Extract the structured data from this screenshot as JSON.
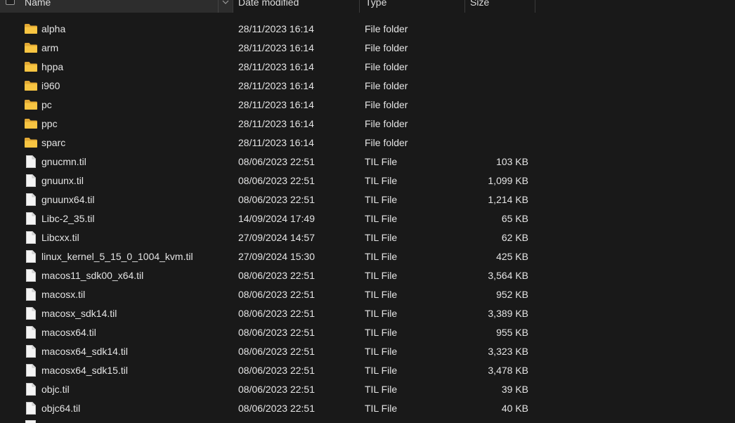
{
  "header": {
    "name": "Name",
    "date_modified": "Date modified",
    "type": "Type",
    "size": "Size"
  },
  "colors": {
    "background": "#191919",
    "folder": "#f8c542",
    "text": "#e4e4e4"
  },
  "files": [
    {
      "name": "alpha",
      "date": "28/11/2023 16:14",
      "type": "File folder",
      "size": "",
      "icon": "folder-icon"
    },
    {
      "name": "arm",
      "date": "28/11/2023 16:14",
      "type": "File folder",
      "size": "",
      "icon": "folder-icon"
    },
    {
      "name": "hppa",
      "date": "28/11/2023 16:14",
      "type": "File folder",
      "size": "",
      "icon": "folder-icon"
    },
    {
      "name": "i960",
      "date": "28/11/2023 16:14",
      "type": "File folder",
      "size": "",
      "icon": "folder-icon"
    },
    {
      "name": "pc",
      "date": "28/11/2023 16:14",
      "type": "File folder",
      "size": "",
      "icon": "folder-icon"
    },
    {
      "name": "ppc",
      "date": "28/11/2023 16:14",
      "type": "File folder",
      "size": "",
      "icon": "folder-icon"
    },
    {
      "name": "sparc",
      "date": "28/11/2023 16:14",
      "type": "File folder",
      "size": "",
      "icon": "folder-icon"
    },
    {
      "name": "gnucmn.til",
      "date": "08/06/2023 22:51",
      "type": "TIL File",
      "size": "103 KB",
      "icon": "file-icon"
    },
    {
      "name": "gnuunx.til",
      "date": "08/06/2023 22:51",
      "type": "TIL File",
      "size": "1,099 KB",
      "icon": "file-icon"
    },
    {
      "name": "gnuunx64.til",
      "date": "08/06/2023 22:51",
      "type": "TIL File",
      "size": "1,214 KB",
      "icon": "file-icon"
    },
    {
      "name": "Libc-2_35.til",
      "date": "14/09/2024 17:49",
      "type": "TIL File",
      "size": "65 KB",
      "icon": "file-icon"
    },
    {
      "name": "Libcxx.til",
      "date": "27/09/2024 14:57",
      "type": "TIL File",
      "size": "62 KB",
      "icon": "file-icon"
    },
    {
      "name": "linux_kernel_5_15_0_1004_kvm.til",
      "date": "27/09/2024 15:30",
      "type": "TIL File",
      "size": "425 KB",
      "icon": "file-icon"
    },
    {
      "name": "macos11_sdk00_x64.til",
      "date": "08/06/2023 22:51",
      "type": "TIL File",
      "size": "3,564 KB",
      "icon": "file-icon"
    },
    {
      "name": "macosx.til",
      "date": "08/06/2023 22:51",
      "type": "TIL File",
      "size": "952 KB",
      "icon": "file-icon"
    },
    {
      "name": "macosx_sdk14.til",
      "date": "08/06/2023 22:51",
      "type": "TIL File",
      "size": "3,389 KB",
      "icon": "file-icon"
    },
    {
      "name": "macosx64.til",
      "date": "08/06/2023 22:51",
      "type": "TIL File",
      "size": "955 KB",
      "icon": "file-icon"
    },
    {
      "name": "macosx64_sdk14.til",
      "date": "08/06/2023 22:51",
      "type": "TIL File",
      "size": "3,323 KB",
      "icon": "file-icon"
    },
    {
      "name": "macosx64_sdk15.til",
      "date": "08/06/2023 22:51",
      "type": "TIL File",
      "size": "3,478 KB",
      "icon": "file-icon"
    },
    {
      "name": "objc.til",
      "date": "08/06/2023 22:51",
      "type": "TIL File",
      "size": "39 KB",
      "icon": "file-icon"
    },
    {
      "name": "objc64.til",
      "date": "08/06/2023 22:51",
      "type": "TIL File",
      "size": "40 KB",
      "icon": "file-icon"
    }
  ]
}
